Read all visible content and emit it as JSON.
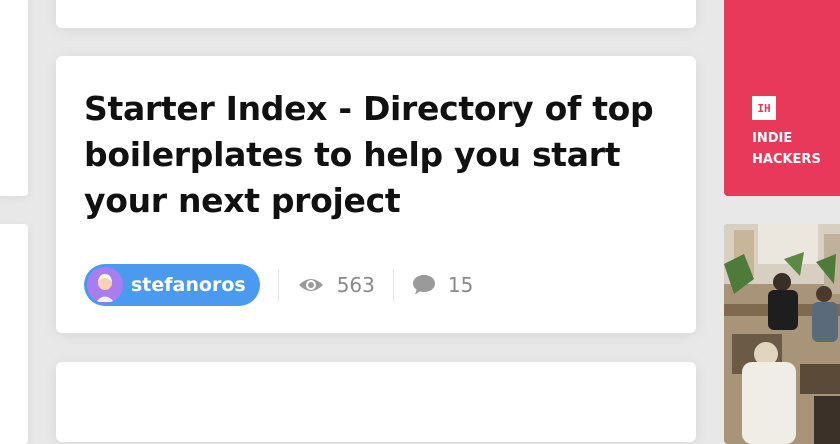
{
  "post": {
    "title": "Starter Index - Directory of top boilerplates to help you start your next project",
    "author": "stefanoros",
    "views": "563",
    "comments": "15"
  },
  "sidebar_ad": {
    "logo": "IH",
    "name": "INDIE HACKERS"
  },
  "icons": {
    "views": "eye-icon",
    "comments": "speech-bubble-icon"
  },
  "colors": {
    "author_pill": "#4a9bf0",
    "avatar_bg": "#a77df0",
    "ad_brand": "#e8395a",
    "meta_text": "#8a8a8a"
  }
}
